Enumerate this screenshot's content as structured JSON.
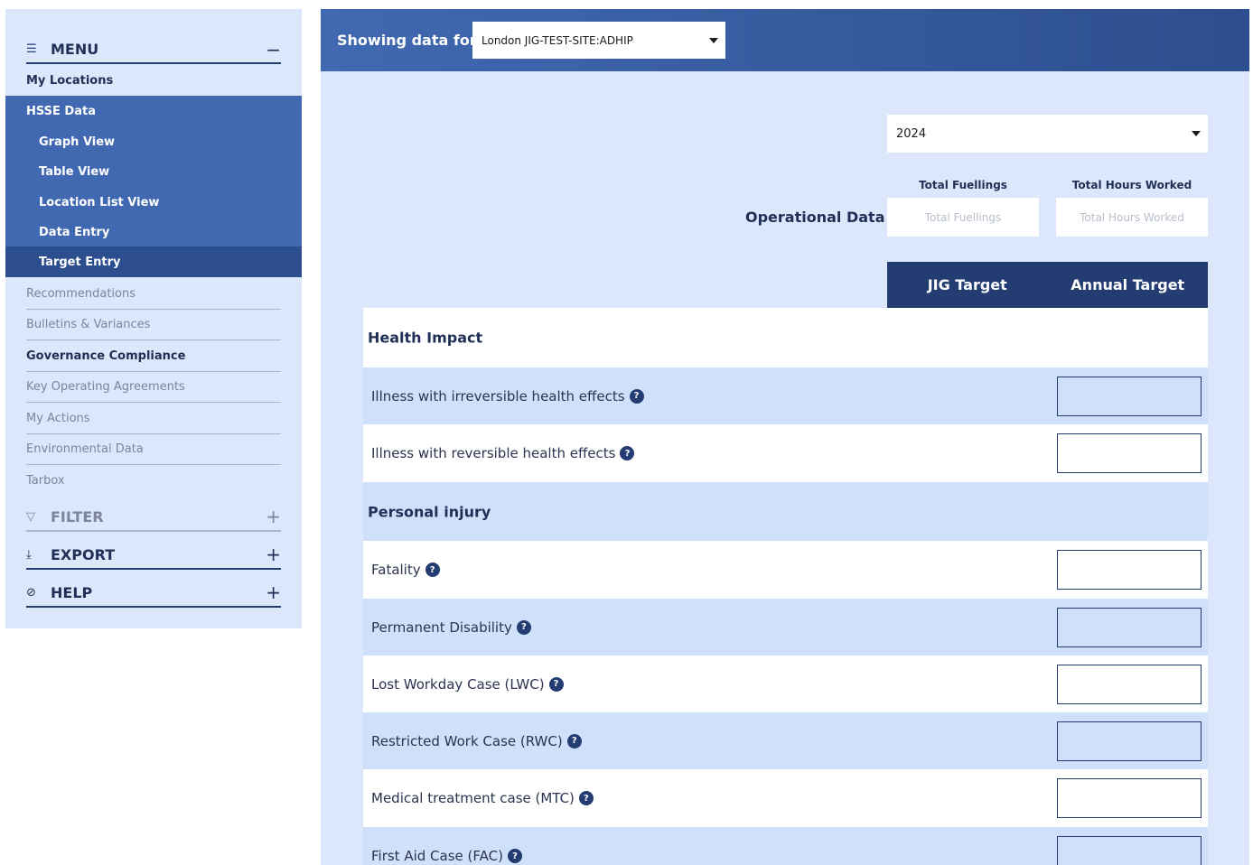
{
  "sidebar": {
    "menu_label": "MENU",
    "menu_toggle": "−",
    "items": {
      "my_locations": "My Locations",
      "hsse_data": "HSSE Data",
      "graph_view": "Graph View",
      "table_view": "Table View",
      "location_list_view": "Location List View",
      "data_entry": "Data Entry",
      "target_entry": "Target Entry",
      "recommendations": "Recommendations",
      "bulletins": "Bulletins & Variances",
      "governance": "Governance Compliance",
      "key_operating": "Key Operating Agreements",
      "my_actions": "My Actions",
      "environmental": "Environmental Data",
      "tarbox": "Tarbox"
    },
    "sections": {
      "filter": "FILTER",
      "export": "EXPORT",
      "help": "HELP",
      "expand": "+"
    }
  },
  "topbar": {
    "showing_label": "Showing data for:",
    "location_value": "London JIG-TEST-SITE:ADHIP"
  },
  "year": "2024",
  "operational": {
    "label": "Operational Data",
    "fuellings_header": "Total Fuellings",
    "hours_header": "Total Hours Worked",
    "fuellings_placeholder": "Total Fuellings",
    "hours_placeholder": "Total Hours Worked"
  },
  "target_columns": {
    "jig": "JIG Target",
    "annual": "Annual Target"
  },
  "sections": {
    "health_impact": "Health Impact",
    "personal_injury": "Personal injury"
  },
  "rows": {
    "irreversible": "Illness with irreversible health effects",
    "reversible": "Illness with reversible health effects",
    "fatality": "Fatality",
    "permanent_disability": "Permanent Disability",
    "lwc": "Lost Workday Case (LWC)",
    "rwc": "Restricted Work Case (RWC)",
    "mtc": "Medical treatment case (MTC)",
    "fac": "First Aid Case (FAC)"
  },
  "help_glyph": "?"
}
